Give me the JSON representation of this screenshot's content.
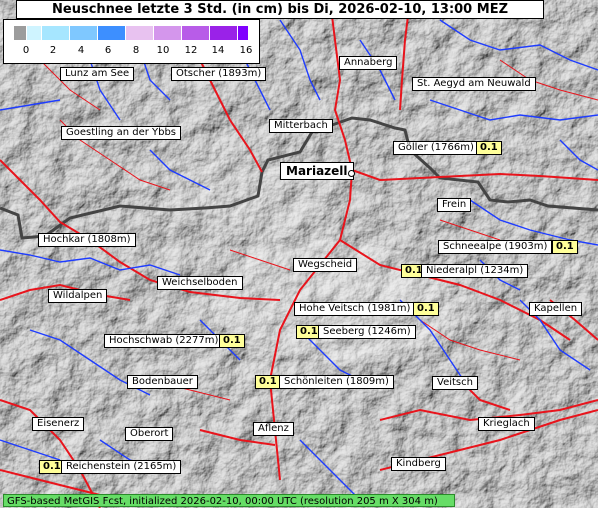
{
  "title": "Neuschnee letzte 3 Std. (in cm) bis Di, 2026-02-10, 13:00 MEZ",
  "legend": {
    "ticks": [
      "0",
      "2",
      "4",
      "6",
      "8",
      "10",
      "12",
      "14",
      "16"
    ],
    "colors": [
      "#9c9c9c",
      "#cff4ff",
      "#a6e6ff",
      "#7fc8ff",
      "#3d8fff",
      "#e8c2f0",
      "#d496ec",
      "#b85ce8",
      "#9a22e8"
    ]
  },
  "places": {
    "lunz": "Lunz am See",
    "oetscher": "Ötscher (1893m)",
    "annaberg": "Annaberg",
    "aegyd": "St. Aegyd am Neuwald",
    "goestling": "Goestling an der Ybbs",
    "mitterbach": "Mitterbach",
    "goeller": "Göller (1766m)",
    "mariazell": "Mariazell",
    "frein": "Frein",
    "hochkar": "Hochkar (1808m)",
    "schneealpe": "Schneealpe (1903m)",
    "wegscheid": "Wegscheid",
    "niederalpl": "Niederalpl (1234m)",
    "weichselboden": "Weichselboden",
    "wildalpen": "Wildalpen",
    "hohe_veitsch": "Hohe Veitsch (1981m)",
    "kapellen": "Kapellen",
    "seeberg": "Seeberg (1246m)",
    "hochschwab": "Hochschwab (2277m)",
    "bodenbauer": "Bodenbauer",
    "schoenleiten": "Schönleiten (1809m)",
    "veitsch": "Veitsch",
    "eisenerz": "Eisenerz",
    "oberort": "Oberort",
    "aflenz": "Aflenz",
    "krieglach": "Krieglach",
    "kindberg": "Kindberg",
    "reichenstein": "Reichenstein (2165m)"
  },
  "values": {
    "goeller": "0.1",
    "schneealpe": "0.1",
    "niederalpl": "0.1",
    "hohe_veitsch": "0.1",
    "seeberg": "0.1",
    "hochschwab": "0.1",
    "schoenleiten": "0.1",
    "reichenstein": "0.1"
  },
  "footer": "GFS-based MetGIS Fcst, initialized 2026-02-10, 00:00 UTC  (resolution 205 m X 304 m)"
}
